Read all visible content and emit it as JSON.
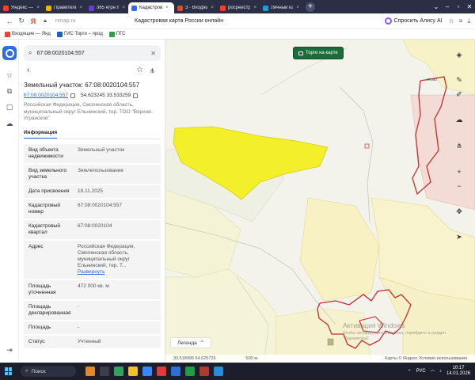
{
  "browser": {
    "tabs": [
      {
        "label": "Яндекс — был",
        "color": "#fc3f1d",
        "active": false
      },
      {
        "label": "Правительст",
        "color": "#f2b400",
        "active": false
      },
      {
        "label": "365 егрн публ",
        "color": "#6a3ed6",
        "active": false
      },
      {
        "label": "Кадастров",
        "color": "#2f6be4",
        "active": true
      },
      {
        "label": "3 · Входящие",
        "color": "#e04a2f",
        "active": false
      },
      {
        "label": "росреестр п",
        "color": "#fc3f1d",
        "active": false
      },
      {
        "label": "Личный каби",
        "color": "#1aa0d8",
        "active": false
      }
    ],
    "url": "nmap.ru",
    "page_title": "Кадастровая карта России онлайн",
    "alisa_label": "Спросить Алису AI",
    "bookmarks": [
      {
        "label": "Входящие — Янд",
        "color": "#e04a2f"
      },
      {
        "label": "ГИС Торги – прод",
        "color": "#1f5fbf"
      },
      {
        "label": "ПГС",
        "color": "#2f9e4b"
      }
    ]
  },
  "panel": {
    "search_value": "67:08:0020104:557",
    "title": "Земельный участок: 67:08:0020104:557",
    "cad_number_link": "67:08:0020104:557",
    "coords": "54.623245 33.533259",
    "address": "Российская Федерация, Смоленская область, муниципальный округ Ельнинский, тер. ТОО \"Верхне-Угранское\"",
    "active_tab": "Информация",
    "rows": [
      {
        "label": "Вид объекта недвижимости",
        "value": "Земельный участок"
      },
      {
        "label": "Вид земельного участка",
        "value": "Землепользование"
      },
      {
        "label": "Дата присвоения",
        "value": "19.11.2025"
      },
      {
        "label": "Кадастровый номер",
        "value": "67:08:0020104:557"
      },
      {
        "label": "Кадастровый квартал",
        "value": "67:08:0020104"
      },
      {
        "label": "Адрес",
        "value": "Российская Федерация, Смоленская область, муниципальный округ Ельнинский, тер. Т...",
        "link": "Развернуть"
      },
      {
        "label": "Площадь уточненная",
        "value": "472 000 кв. м"
      },
      {
        "label": "Площадь декларированная",
        "value": "-"
      },
      {
        "label": "Площадь",
        "value": "-"
      },
      {
        "label": "Статус",
        "value": "Учтенный"
      }
    ]
  },
  "map": {
    "torgi_button": "Торги на карте",
    "legend_label": "Легенда",
    "footer_coords": "33.518996  54.625726",
    "footer_scale": "500 м",
    "footer_right": "Карты © Яндекс  Условия использования",
    "watermark_title": "Активация Windows",
    "watermark_text": "Чтобы активировать Windows, перейдите в раздел \"Параметры\".",
    "place_label": "отово",
    "selected_color": "#f3ef2a",
    "border_color": "#c72c2c"
  },
  "taskbar": {
    "search_label": "Поиск",
    "lang": "РУС",
    "time": "10:17",
    "date": "14.01.2026"
  }
}
